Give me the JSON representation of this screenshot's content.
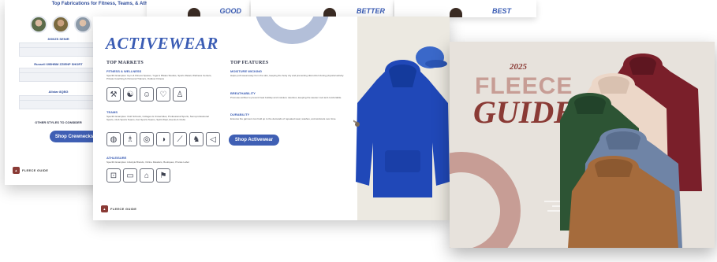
{
  "back_page": {
    "subtitle": "Top Fabrications for Fitness, Teams, & Athleisure",
    "sku_names": [
      "3000ZS SENIR",
      "Russell 695HBM ZZIENP SHORT",
      "Allstar 8QBG"
    ],
    "other_styles": "OTHER STYLES TO CONSIDER",
    "shop_button": "Shop Crewnecks",
    "brand": "FLEECE GUIDE"
  },
  "tiers": [
    {
      "label": "GOOD"
    },
    {
      "label": "BETTER"
    },
    {
      "label": "BEST"
    }
  ],
  "activewear": {
    "title": "ACTIVEWEAR",
    "top_markets_heading": "TOP MARKETS",
    "top_features_heading": "TOP FEATURES",
    "markets": [
      {
        "name": "FITNESS & WELLNESS",
        "desc": "Specific Examples: Gym & Fitness Spaces, Yoga & Pilates Studios, Sports Retail, Wellness Centers, Private Coaching & Personal Trainers, Outdoor Fitness"
      },
      {
        "name": "TEAMS",
        "desc": "Specific Examples: Club Schools, Colleges & Universities, Professional Sports, Semi-professional Sports, Club Sports Teams, Fan Sports Teams, Spirit Wear, Events & Clubs"
      },
      {
        "name": "ATHLEISURE",
        "desc": "Specific Examples: Lifestyle Brands, Online Retailers, Boutiques, Private Label"
      }
    ],
    "features": [
      {
        "name": "MOISTURE WICKING",
        "desc": "Helps pull sweat away from the skin, keeping the body dry and preventing discomfort during physical activity."
      },
      {
        "name": "BREATHABILITY",
        "desc": "Promotes airflow to prevent heat buildup and moisture retention, keeping the wearer cool and comfortable."
      },
      {
        "name": "DURABILITY",
        "desc": "Ensures the garment can hold up to the demands of repeated wear, washes, and workouts over time."
      }
    ],
    "shop_button": "Shop Activewear",
    "brand": "FLEECE GUIDE",
    "icons_row1": [
      "dumbbell-icon",
      "meditation-icon",
      "family-icon",
      "heart-icon",
      "trainer-icon"
    ],
    "icons_row2": [
      "basketball-icon",
      "bowling-icon",
      "target-icon",
      "volleyball-icon",
      "hockey-icon",
      "team-icon",
      "megaphone-icon"
    ],
    "icons_row3": [
      "shopping-bag-icon",
      "online-store-icon",
      "boutique-icon",
      "tag-icon"
    ]
  },
  "cover": {
    "year": "2025",
    "line1": "FLEECE",
    "line2": "GUIDE"
  },
  "colors": {
    "accent_blue": "#3a5cb4",
    "brand_red": "#8a3a35",
    "dusty_pink": "#c79d95",
    "hoodie_blue": "#2048b8"
  }
}
